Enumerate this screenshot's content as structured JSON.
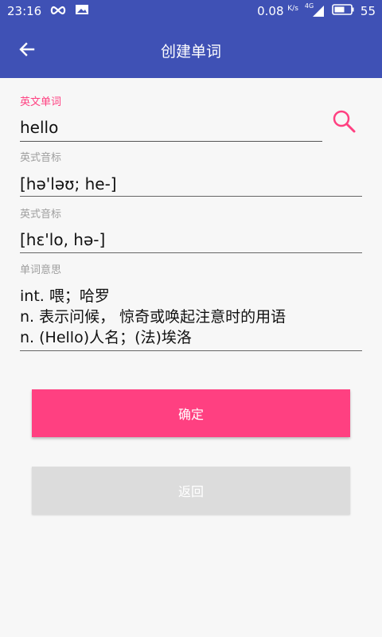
{
  "status_bar": {
    "time": "23:16",
    "network_speed": "0.08",
    "network_unit": "K/s",
    "network_type": "4G",
    "battery_level": "55",
    "icons": [
      "infinity-icon",
      "image-notification-icon",
      "signal-icon",
      "battery-icon"
    ]
  },
  "toolbar": {
    "title": "创建单词",
    "back_icon": "arrow-left-icon"
  },
  "form": {
    "word": {
      "label": "英文单词",
      "value": "hello"
    },
    "phonetic_uk": {
      "label": "英式音标",
      "value": "[hə'ləʊ; he-]"
    },
    "phonetic_us": {
      "label": "英式音标",
      "value": "[hɛ'lo, hə-]"
    },
    "meaning": {
      "label": "单词意思",
      "lines": [
        "int. 喂；哈罗",
        "n. 表示问候， 惊奇或唤起注意时的用语",
        "n. (Hello)人名；(法)埃洛"
      ]
    },
    "search_icon": "search-icon"
  },
  "buttons": {
    "confirm": "确定",
    "back": "返回"
  },
  "colors": {
    "primary": "#3f51b5",
    "accent": "#ff4081",
    "disabled": "#dcdcdc"
  }
}
